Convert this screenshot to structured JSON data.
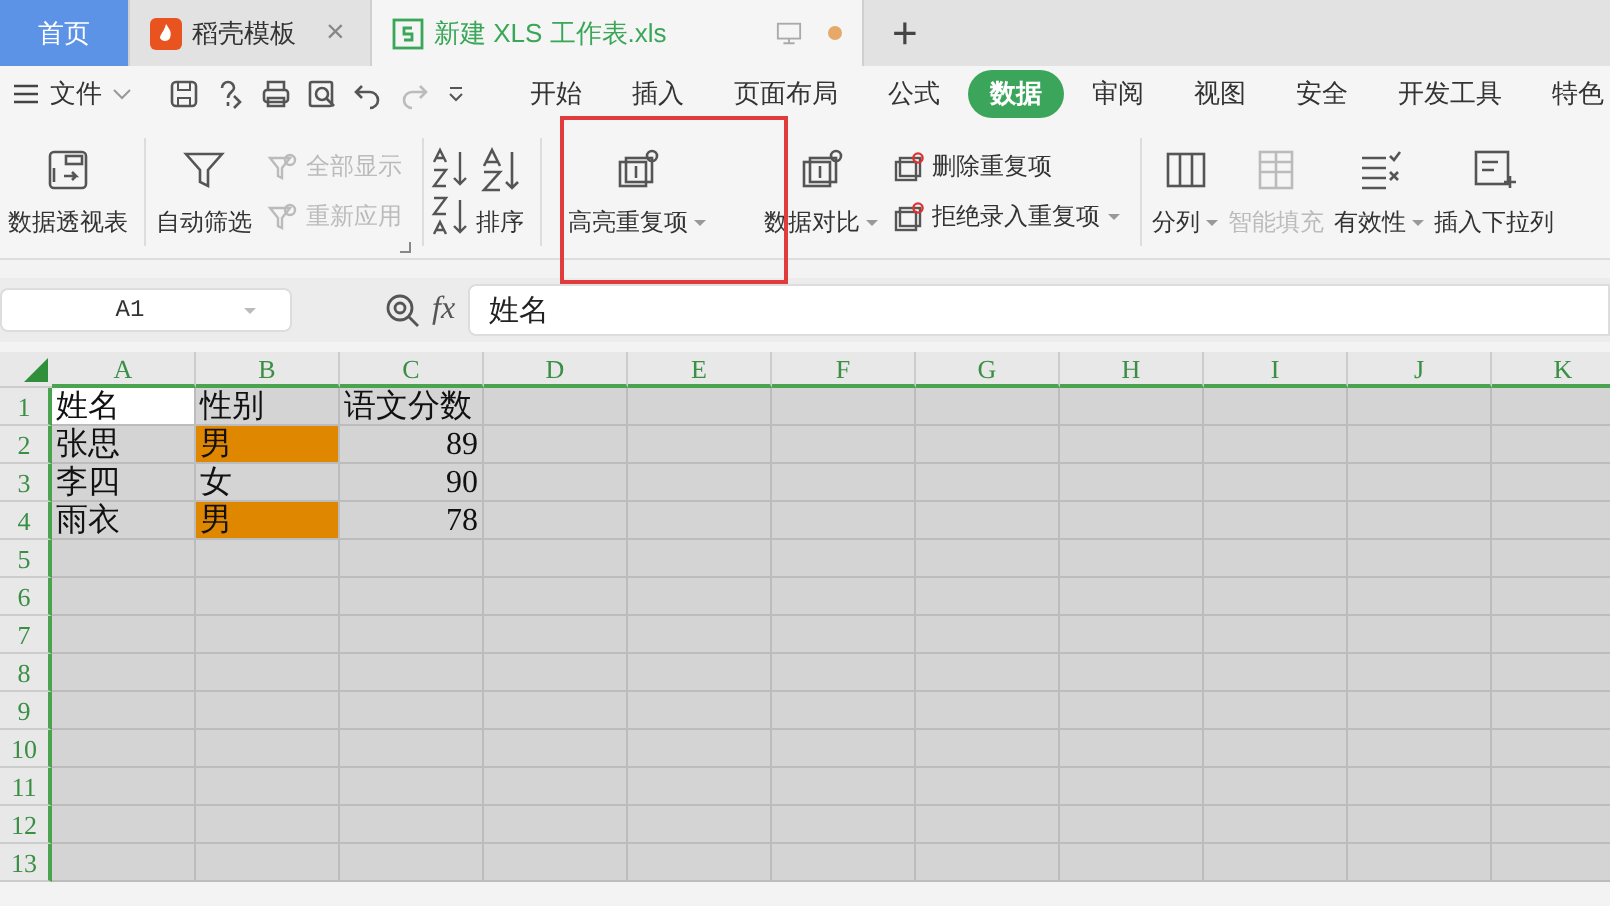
{
  "tabs": [
    {
      "label": "首页",
      "kind": "home",
      "selected": false
    },
    {
      "label": "稻壳模板",
      "kind": "docer",
      "selected": false,
      "close": "×"
    },
    {
      "label": "新建 XLS 工作表.xls",
      "kind": "sheet",
      "selected": true,
      "unsaved": true
    }
  ],
  "new_tab": "+",
  "menu": {
    "file": "文件",
    "tabs": [
      {
        "label": "开始",
        "selected": false
      },
      {
        "label": "插入",
        "selected": false
      },
      {
        "label": "页面布局",
        "selected": false
      },
      {
        "label": "公式",
        "selected": false
      },
      {
        "label": "数据",
        "selected": true
      },
      {
        "label": "审阅",
        "selected": false
      },
      {
        "label": "视图",
        "selected": false
      },
      {
        "label": "安全",
        "selected": false
      },
      {
        "label": "开发工具",
        "selected": false
      },
      {
        "label": "特色"
      }
    ]
  },
  "ribbon": [
    {
      "items": [
        {
          "kind": "big",
          "label": "数据透视表",
          "disabled": false,
          "dropdown": false
        }
      ]
    },
    {
      "launcher": true,
      "items": [
        {
          "kind": "big",
          "label": "自动筛选",
          "disabled": false,
          "dropdown": false
        },
        {
          "kind": "stack",
          "items": [
            {
              "label": "全部显示",
              "disabled": true,
              "dropdown": false
            },
            {
              "label": "重新应用",
              "disabled": true,
              "dropdown": false
            }
          ]
        }
      ]
    },
    {
      "items": [
        {
          "kind": "iconstack"
        },
        {
          "kind": "big",
          "label": "排序",
          "disabled": false,
          "dropdown": false
        }
      ]
    },
    {
      "items": [
        {
          "kind": "big",
          "label": "高亮重复项",
          "disabled": false,
          "dropdown": true,
          "highlighted": true
        },
        {
          "kind": "big",
          "label": "数据对比",
          "disabled": false,
          "dropdown": true
        },
        {
          "kind": "stack",
          "items": [
            {
              "label": "删除重复项",
              "disabled": false,
              "dropdown": false
            },
            {
              "label": "拒绝录入重复项",
              "disabled": false,
              "dropdown": true
            }
          ]
        }
      ]
    },
    {
      "items": [
        {
          "kind": "big",
          "label": "分列",
          "disabled": false,
          "dropdown": true
        },
        {
          "kind": "big",
          "label": "智能填充",
          "disabled": true,
          "dropdown": false
        },
        {
          "kind": "big",
          "label": "有效性",
          "disabled": false,
          "dropdown": true
        },
        {
          "kind": "big",
          "label": "插入下拉列",
          "disabled": false,
          "dropdown": false
        }
      ]
    }
  ],
  "name_box": "A1",
  "formula": "姓名",
  "fx": "fx",
  "columns": [
    "A",
    "B",
    "C",
    "D",
    "E",
    "F",
    "G",
    "H",
    "I",
    "J",
    "K"
  ],
  "rows": [
    {
      "number": "1",
      "cells": [
        {
          "text": "姓名",
          "highlight": false,
          "active": true,
          "numeric": false
        },
        {
          "text": "性别",
          "highlight": false,
          "active": false,
          "numeric": false
        },
        {
          "text": "语文分数",
          "highlight": false,
          "active": false,
          "numeric": false
        }
      ]
    },
    {
      "number": "2",
      "cells": [
        {
          "text": "张思",
          "highlight": false,
          "active": false,
          "numeric": false
        },
        {
          "text": "男",
          "highlight": true,
          "active": false,
          "numeric": false
        },
        {
          "text": "89",
          "highlight": false,
          "active": false,
          "numeric": true
        }
      ]
    },
    {
      "number": "3",
      "cells": [
        {
          "text": "李四",
          "highlight": false,
          "active": false,
          "numeric": false
        },
        {
          "text": "女",
          "highlight": false,
          "active": false,
          "numeric": false
        },
        {
          "text": "90",
          "highlight": false,
          "active": false,
          "numeric": true
        }
      ]
    },
    {
      "number": "4",
      "cells": [
        {
          "text": "雨衣",
          "highlight": false,
          "active": false,
          "numeric": false
        },
        {
          "text": "男",
          "highlight": true,
          "active": false,
          "numeric": false
        },
        {
          "text": "78",
          "highlight": false,
          "active": false,
          "numeric": true
        }
      ]
    },
    {
      "number": "5",
      "cells": []
    },
    {
      "number": "6",
      "cells": []
    },
    {
      "number": "7",
      "cells": []
    },
    {
      "number": "8",
      "cells": []
    },
    {
      "number": "9",
      "cells": []
    },
    {
      "number": "10",
      "cells": []
    },
    {
      "number": "11",
      "cells": []
    },
    {
      "number": "12",
      "cells": []
    },
    {
      "number": "13",
      "cells": []
    }
  ]
}
